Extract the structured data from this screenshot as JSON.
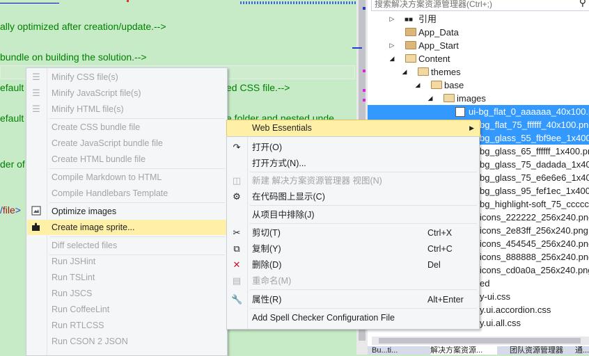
{
  "editor": {
    "lines": [
      "ally optimized after creation/update.-->",
      "bundle on building the solution.-->",
      "efault",
      "ed CSS file.-->",
      "efault",
      "e folder and nested unde",
      "der of"
    ],
    "file_tag_open": "/",
    "file_tag_name": "file",
    "file_tag_close": ">"
  },
  "solution_explorer": {
    "search_placeholder": "搜索解决方案资源管理器(Ctrl+;)",
    "tree": [
      {
        "label": "引用",
        "icon": "references-icon"
      },
      {
        "label": "App_Data",
        "icon": "folder-icon"
      },
      {
        "label": "App_Start",
        "icon": "folder-icon"
      },
      {
        "label": "Content",
        "icon": "folder-open-icon"
      },
      {
        "label": "themes",
        "icon": "folder-open-icon"
      },
      {
        "label": "base",
        "icon": "folder-open-icon"
      },
      {
        "label": "images",
        "icon": "folder-open-icon"
      },
      {
        "label": "ui-bg_flat_0_aaaaaa_40x100.p",
        "icon": "image-file-icon"
      },
      {
        "label": "bg_flat_75_ffffff_40x100.png"
      },
      {
        "label": "bg_glass_55_fbf9ee_1x400"
      },
      {
        "label": "bg_glass_65_ffffff_1x400.pn"
      },
      {
        "label": "bg_glass_75_dadada_1x40"
      },
      {
        "label": "bg_glass_75_e6e6e6_1x40("
      },
      {
        "label": "bg_glass_95_fef1ec_1x400."
      },
      {
        "label": "bg_highlight-soft_75_ccccc"
      },
      {
        "label": "icons_222222_256x240.png"
      },
      {
        "label": "icons_2e83ff_256x240.png"
      },
      {
        "label": "icons_454545_256x240.png"
      },
      {
        "label": "icons_888888_256x240.png"
      },
      {
        "label": "icons_cd0a0a_256x240.png"
      },
      {
        "label": "ed"
      },
      {
        "label": "y-ui.css"
      },
      {
        "label": "y.ui.accordion.css"
      },
      {
        "label": "y.ui.all.css"
      }
    ],
    "tabs": [
      "Bu...ti...",
      "解决方案资源...",
      "团队资源管理器",
      "通..."
    ]
  },
  "context_menu_left": {
    "items": [
      {
        "label": "Minify CSS file(s)",
        "disabled": true
      },
      {
        "label": "Minify JavaScript file(s)",
        "disabled": true
      },
      {
        "label": "Minify HTML file(s)",
        "disabled": true
      },
      {
        "label": "Create CSS bundle file",
        "disabled": true
      },
      {
        "label": "Create JavaScript bundle file",
        "disabled": true
      },
      {
        "label": "Create HTML bundle file",
        "disabled": true
      },
      {
        "label": "Compile Markdown to HTML",
        "disabled": true
      },
      {
        "label": "Compile Handlebars Template",
        "disabled": true
      },
      {
        "label": "Optimize images",
        "disabled": false
      },
      {
        "label": "Create image sprite...",
        "disabled": false,
        "highlighted": true
      },
      {
        "label": "Diff selected files",
        "disabled": true
      },
      {
        "label": "Run JSHint",
        "disabled": true
      },
      {
        "label": "Run TSLint",
        "disabled": true
      },
      {
        "label": "Run JSCS",
        "disabled": true
      },
      {
        "label": "Run CoffeeLint",
        "disabled": true
      },
      {
        "label": "Run RTLCSS",
        "disabled": true
      },
      {
        "label": "Run CSON 2 JSON",
        "disabled": true
      }
    ]
  },
  "web_essentials_item": {
    "label": "Web Essentials"
  },
  "context_menu_right": {
    "items": [
      {
        "label": "打开(O)",
        "shortcut": "",
        "disabled": false
      },
      {
        "label": "打开方式(N)...",
        "shortcut": "",
        "disabled": false
      },
      {
        "label": "新建 解决方案资源管理器 视图(N)",
        "shortcut": "",
        "disabled": true
      },
      {
        "label": "在代码图上显示(C)",
        "shortcut": "",
        "disabled": false
      },
      {
        "label": "从项目中排除(J)",
        "shortcut": "",
        "disabled": false
      },
      {
        "label": "剪切(T)",
        "shortcut": "Ctrl+X",
        "disabled": false
      },
      {
        "label": "复制(Y)",
        "shortcut": "Ctrl+C",
        "disabled": false
      },
      {
        "label": "删除(D)",
        "shortcut": "Del",
        "disabled": false
      },
      {
        "label": "重命名(M)",
        "shortcut": "",
        "disabled": true
      },
      {
        "label": "属性(R)",
        "shortcut": "Alt+Enter",
        "disabled": false
      },
      {
        "label": "Add Spell Checker Configuration File",
        "shortcut": "",
        "disabled": false
      }
    ]
  }
}
